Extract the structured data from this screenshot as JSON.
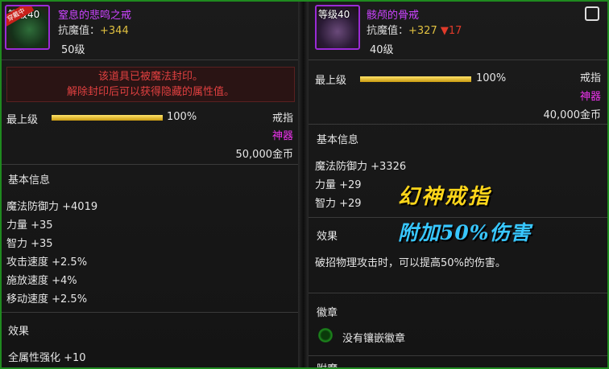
{
  "left": {
    "icon_level": "等级40",
    "equipped_tag": "穿戴中",
    "name": "窒息的悲鸣之戒",
    "resist_label": "抗魔值：",
    "resist_value": "+344",
    "item_level": "50级",
    "seal_line1": "该道具已被魔法封印。",
    "seal_line2": "解除封印后可以获得隐藏的属性值。",
    "grade_label": "最上级",
    "grade_percent": "100%",
    "grade_fill": 1.0,
    "type": "戒指",
    "rarity": "神器",
    "price": "50,000金币",
    "basic_info_title": "基本信息",
    "stats": [
      "魔法防御力 +4019",
      "力量 +35",
      "智力 +35",
      "攻击速度 +2.5%",
      "施放速度 +4%",
      "移动速度 +2.5%"
    ],
    "effect_title": "效果",
    "effects": [
      "全属性强化 +10"
    ]
  },
  "right": {
    "icon_level": "等级40",
    "name": "骸颅的骨戒",
    "resist_label": "抗魔值：",
    "resist_value": "+327",
    "resist_diff": "▼17",
    "item_level": "40级",
    "grade_label": "最上级",
    "grade_percent": "100%",
    "grade_fill": 1.0,
    "type": "戒指",
    "rarity": "神器",
    "price": "40,000金币",
    "basic_info_title": "基本信息",
    "stats": [
      "魔法防御力 +3326",
      "力量 +29",
      "智力 +29"
    ],
    "effect_title": "效果",
    "effect_text": "破招物理攻击时，可以提高50%的伤害。",
    "emblem_title": "徽章",
    "emblem_text": "没有镶嵌徽章",
    "next_title_partial": "附魔"
  },
  "overlay": {
    "title": "幻神戒指",
    "subtitle": "附加50%伤害"
  },
  "colors": {
    "frame": "#1f8a1f",
    "item_name": "#cc44ff",
    "rarity": "#ee33ee",
    "seal_text": "#e04040",
    "overlay_title": "#ffd61a",
    "overlay_sub": "#38c7ff"
  }
}
